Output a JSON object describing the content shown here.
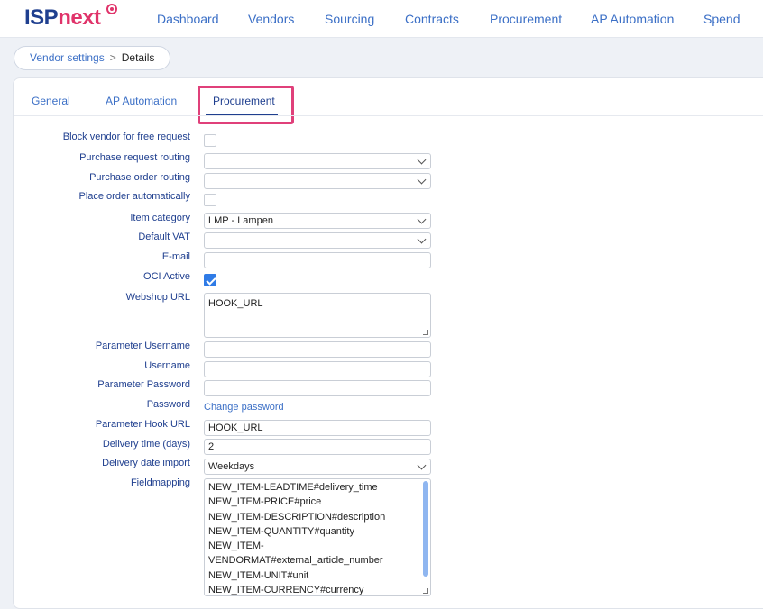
{
  "brand": {
    "part1": "ISP",
    "part2": "next"
  },
  "nav": [
    "Dashboard",
    "Vendors",
    "Sourcing",
    "Contracts",
    "Procurement",
    "AP Automation",
    "Spend"
  ],
  "breadcrumb": {
    "parent": "Vendor settings",
    "separator": ">",
    "current": "Details"
  },
  "tabs": [
    "General",
    "AP Automation",
    "Procurement"
  ],
  "form": {
    "block_vendor_label": "Block vendor for free request",
    "purchase_request_routing_label": "Purchase request routing",
    "purchase_request_routing_value": "",
    "purchase_order_routing_label": "Purchase order routing",
    "purchase_order_routing_value": "",
    "place_order_label": "Place order automatically",
    "item_category_label": "Item category",
    "item_category_value": "LMP - Lampen",
    "default_vat_label": "Default VAT",
    "default_vat_value": "",
    "email_label": "E-mail",
    "email_value": "",
    "oci_active_label": "OCI Active",
    "webshop_url_label": "Webshop URL",
    "webshop_url_value": "HOOK_URL",
    "param_username_label": "Parameter Username",
    "param_username_value": "",
    "username_label": "Username",
    "username_value": "",
    "param_password_label": "Parameter Password",
    "param_password_value": "",
    "password_label": "Password",
    "change_password_link": "Change password",
    "param_hook_url_label": "Parameter Hook URL",
    "param_hook_url_value": "HOOK_URL",
    "delivery_time_label": "Delivery time (days)",
    "delivery_time_value": "2",
    "delivery_date_import_label": "Delivery date import",
    "delivery_date_import_value": "Weekdays",
    "fieldmapping_label": "Fieldmapping",
    "fieldmapping_items": [
      "NEW_ITEM-LEADTIME#delivery_time",
      "NEW_ITEM-PRICE#price",
      "NEW_ITEM-DESCRIPTION#description",
      "NEW_ITEM-QUANTITY#quantity",
      "NEW_ITEM-VENDORMAT#external_article_number",
      "NEW_ITEM-UNIT#unit",
      "NEW_ITEM-CURRENCY#currency"
    ]
  },
  "colors": {
    "brand_blue": "#1f3f8f",
    "brand_pink": "#e0336a",
    "link_blue": "#3b6fc6",
    "highlight": "#e0407a",
    "checkbox_checked": "#2f7be6"
  }
}
